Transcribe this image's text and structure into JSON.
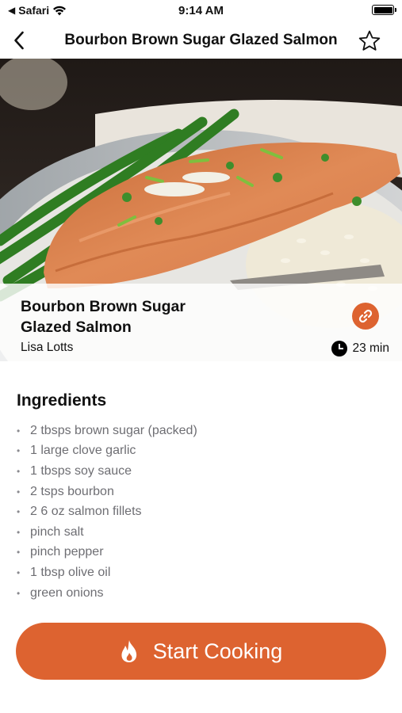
{
  "status_bar": {
    "carrier": "Safari",
    "time": "9:14 AM"
  },
  "nav": {
    "title": "Bourbon Brown Sugar Glazed Salmon"
  },
  "recipe": {
    "title": "Bourbon Brown Sugar Glazed Salmon",
    "author": "Lisa Lotts",
    "time": "23 min"
  },
  "ingredients": {
    "heading": "Ingredients",
    "items": [
      "2 tbsps brown sugar (packed)",
      "1 large clove garlic",
      "1 tbsps soy sauce",
      "2 tsps bourbon",
      "2 6 oz salmon fillets",
      "pinch salt",
      "pinch pepper",
      "1 tbsp olive oil",
      "green onions"
    ]
  },
  "actions": {
    "start_label": "Start Cooking"
  },
  "colors": {
    "accent": "#dd6330"
  },
  "icons": {
    "back": "chevron-left-icon",
    "favorite": "star-icon",
    "link": "link-icon",
    "time": "clock-icon",
    "start": "flame-icon"
  }
}
